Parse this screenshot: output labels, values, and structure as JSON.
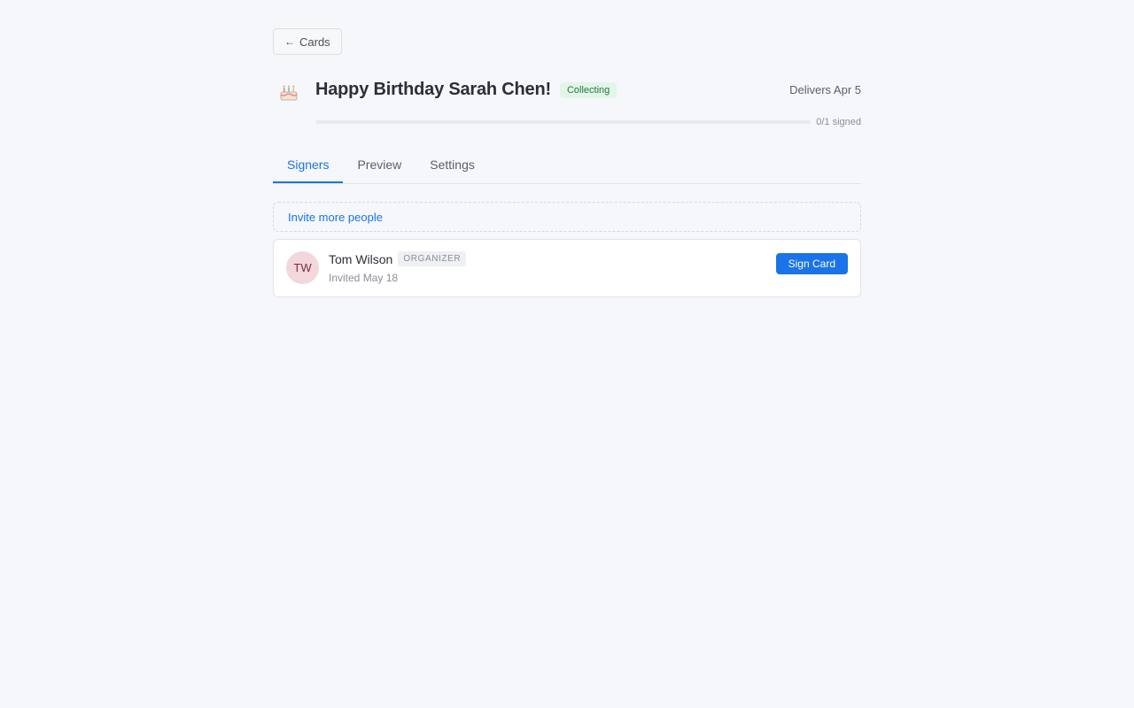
{
  "back": {
    "label": "Cards"
  },
  "card": {
    "icon": "cake-icon",
    "title": "Happy Birthday Sarah Chen!",
    "status": "Collecting",
    "delivers": "Delivers Apr 5",
    "progress_label": "0/1 signed",
    "progress_fraction": 0
  },
  "tabs": [
    {
      "label": "Signers",
      "active": true
    },
    {
      "label": "Preview",
      "active": false
    },
    {
      "label": "Settings",
      "active": false
    }
  ],
  "invite": {
    "label": "Invite more people"
  },
  "signers": [
    {
      "initials": "TW",
      "name": "Tom Wilson",
      "role": "ORGANIZER",
      "invited": "Invited May 18",
      "action": "Sign Card"
    }
  ],
  "colors": {
    "accent": "#1a73e8",
    "status_bg": "#e3f5e8",
    "status_text": "#1e7a3e",
    "avatar_bg": "#f2d7dc"
  }
}
